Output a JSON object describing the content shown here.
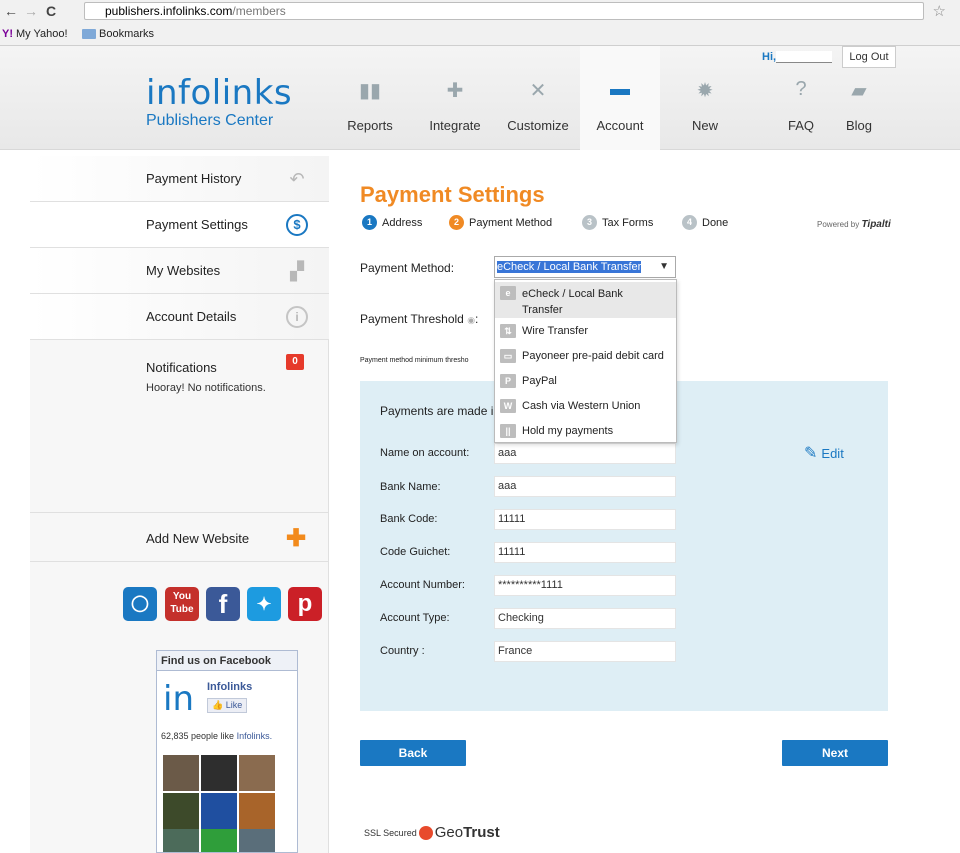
{
  "browser": {
    "url_host": "publishers.infolinks.com",
    "url_path": "/members",
    "bookmarks": [
      "My Yahoo!",
      "Bookmarks"
    ]
  },
  "header": {
    "logo_word": "infolinks",
    "logo_sub": "Publishers Center",
    "greeting": "Hi,",
    "logout_label": "Log Out",
    "nav": [
      {
        "label": "Reports"
      },
      {
        "label": "Integrate"
      },
      {
        "label": "Customize"
      },
      {
        "label": "Account"
      },
      {
        "label": "New"
      },
      {
        "label": "FAQ"
      },
      {
        "label": "Blog"
      }
    ]
  },
  "sidebar": {
    "items": [
      {
        "label": "Payment History"
      },
      {
        "label": "Payment Settings"
      },
      {
        "label": "My Websites"
      },
      {
        "label": "Account Details"
      }
    ],
    "notifications_title": "Notifications",
    "notifications_text": "Hooray! No notifications.",
    "notifications_count": "0",
    "add_website": "Add New Website",
    "social": {
      "youtube_top": "You",
      "youtube_bottom": "Tube",
      "facebook": "f",
      "pinterest": "p"
    },
    "facebook_box": {
      "header": "Find us on Facebook",
      "page_name": "Infolinks",
      "like_label": "Like",
      "count_text": "62,835 people like",
      "count_link": "Infolinks."
    }
  },
  "main": {
    "title": "Payment Settings",
    "steps": [
      {
        "num": "1",
        "label": "Address"
      },
      {
        "num": "2",
        "label": "Payment Method"
      },
      {
        "num": "3",
        "label": "Tax Forms"
      },
      {
        "num": "4",
        "label": "Done"
      }
    ],
    "powered_by": "Powered by",
    "powered_brand": "Tipalti",
    "payment_method_label": "Payment Method:",
    "payment_method_value": "eCheck / Local Bank Transfer",
    "threshold_label": "Payment Threshold",
    "threshold_note": "Payment method minimum thresho",
    "payments_made_text": "Payments are made in",
    "edit_label": "Edit",
    "fields": [
      {
        "label": "Name on account:",
        "value": "aaa"
      },
      {
        "label": "Bank Name:",
        "value": "aaa"
      },
      {
        "label": "Bank Code:",
        "value": "11111"
      },
      {
        "label": "Code Guichet:",
        "value": "11111"
      },
      {
        "label": "Account Number:",
        "value": "**********1111"
      },
      {
        "label": "Account Type:",
        "value": "Checking"
      },
      {
        "label": "Country :",
        "value": "France"
      }
    ],
    "dropdown_options": [
      {
        "label": "eCheck / Local Bank Transfer",
        "icon": "e"
      },
      {
        "label": "Wire Transfer",
        "icon": "w"
      },
      {
        "label": "Payoneer pre-paid debit card",
        "icon": "card"
      },
      {
        "label": "PayPal",
        "icon": "P"
      },
      {
        "label": "Cash via Western Union",
        "icon": "W"
      },
      {
        "label": "Hold my payments",
        "icon": "||"
      }
    ],
    "back_label": "Back",
    "next_label": "Next",
    "ssl_text": "SSL Secured",
    "ssl_brand_a": "Geo",
    "ssl_brand_b": "Trust"
  },
  "colors": {
    "accent": "#1a78c2",
    "title_orange": "#f08a24",
    "info_bg": "#deeef5"
  }
}
